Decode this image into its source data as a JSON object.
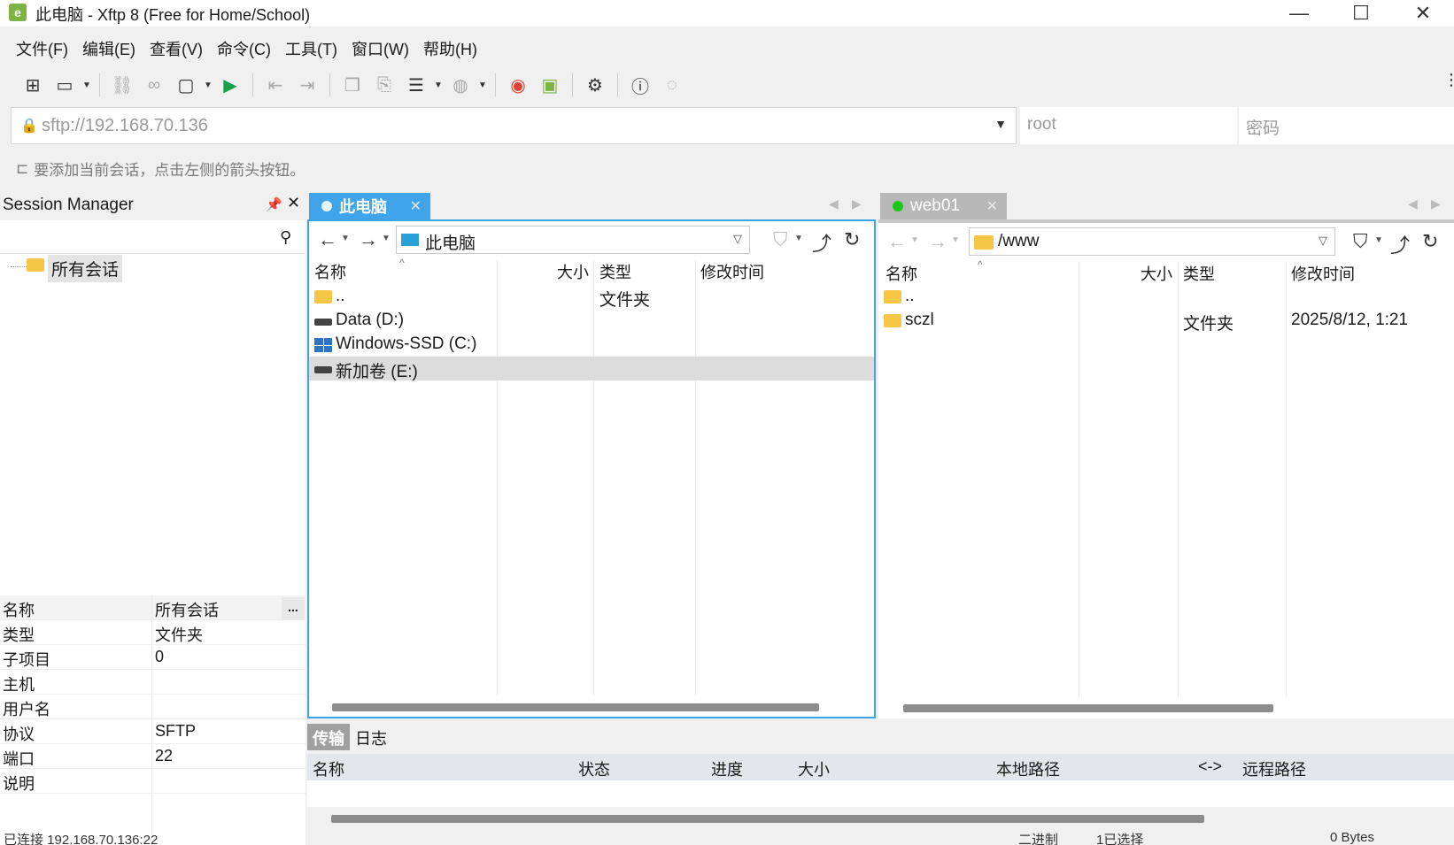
{
  "window": {
    "title": "此电脑 - Xftp 8 (Free for Home/School)",
    "logo": "e",
    "minimize": "—",
    "maximize": "☐",
    "close": "✕"
  },
  "menu": [
    "文件(F)",
    "编辑(E)",
    "查看(V)",
    "命令(C)",
    "工具(T)",
    "窗口(W)",
    "帮助(H)"
  ],
  "address": {
    "url": "sftp://192.168.70.136",
    "user_placeholder": "root",
    "password_placeholder": "密码"
  },
  "hint": "要添加当前会话，点击左侧的箭头按钮。",
  "session_manager": {
    "title": "Session Manager",
    "pin": "📌",
    "close": "✕",
    "tree_root": "所有会话",
    "more_button": "...",
    "properties": [
      {
        "key": "名称",
        "value": "所有会话"
      },
      {
        "key": "类型",
        "value": "文件夹"
      },
      {
        "key": "子项目",
        "value": "0"
      },
      {
        "key": "主机",
        "value": ""
      },
      {
        "key": "用户名",
        "value": ""
      },
      {
        "key": "协议",
        "value": "SFTP"
      },
      {
        "key": "端口",
        "value": "22"
      },
      {
        "key": "说明",
        "value": ""
      }
    ]
  },
  "left_pane": {
    "tab": "此电脑",
    "tab_dot_color": "#ffffff",
    "path": "此电脑",
    "columns": {
      "name": "名称",
      "size": "大小",
      "type": "类型",
      "modified": "修改时间"
    },
    "files": [
      {
        "name": "..",
        "type": "文件夹",
        "modified": "",
        "icon": "folder"
      },
      {
        "name": "Data (D:)",
        "type": "",
        "modified": "",
        "icon": "drive"
      },
      {
        "name": "Windows-SSD (C:)",
        "type": "",
        "modified": "",
        "icon": "windows-drive"
      },
      {
        "name": "新加卷 (E:)",
        "type": "",
        "modified": "",
        "icon": "drive",
        "selected": true
      }
    ]
  },
  "right_pane": {
    "tab": "web01",
    "tab_dot_color": "#19c919",
    "path": "/www",
    "columns": {
      "name": "名称",
      "size": "大小",
      "type": "类型",
      "modified": "修改时间"
    },
    "files": [
      {
        "name": "..",
        "type": "",
        "modified": "",
        "icon": "folder"
      },
      {
        "name": "sczl",
        "type": "文件夹",
        "modified": "2025/8/12, 1:21",
        "icon": "folder"
      }
    ]
  },
  "transfer": {
    "tabs": [
      "传输",
      "日志"
    ],
    "columns": {
      "name": "名称",
      "status": "状态",
      "progress": "进度",
      "size": "大小",
      "local": "本地路径",
      "arrow": "<->",
      "remote": "远程路径"
    }
  },
  "status": {
    "connection": "已连接 192.168.70.136:22",
    "mode": "二进制",
    "selected": "1已选择",
    "bytes": "0 Bytes"
  },
  "colors": {
    "accent": "#3fa4ea",
    "logo": "#7cb342",
    "connected": "#19c919"
  }
}
